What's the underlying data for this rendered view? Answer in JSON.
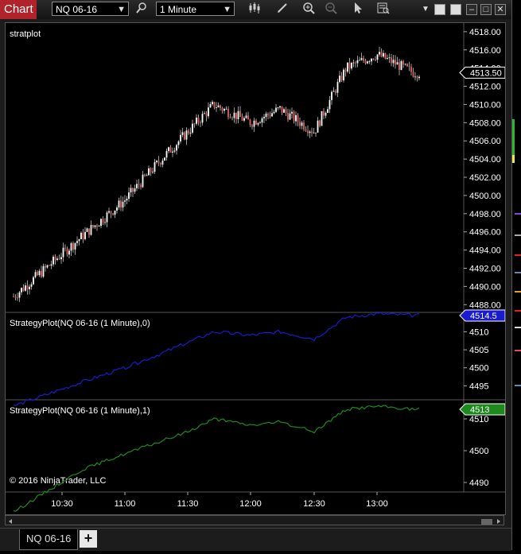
{
  "window": {
    "title": "Chart"
  },
  "toolbar": {
    "instrument": "NQ 06-16",
    "interval": "1 Minute",
    "icons": [
      "search-icon",
      "candlestick-style-icon",
      "draw-tool-icon",
      "zoom-in-icon",
      "zoom-out-icon",
      "pointer-icon",
      "data-box-icon",
      "dropdown-icon"
    ]
  },
  "tabs": [
    {
      "label": "NQ 06-16"
    }
  ],
  "add_tab_label": "+",
  "colors": {
    "background": "#000000",
    "price_line": "#ffffff",
    "plot1": "#1a1ad0",
    "plot2": "#1e8a1e",
    "up_candle": "#ffffff",
    "down_candle": "#e06060",
    "wick": "#dddddd"
  },
  "panels": [
    {
      "label": "stratplot",
      "y_ticks": [
        "4518.00",
        "4516.00",
        "4514.00",
        "4512.00",
        "4510.00",
        "4508.00",
        "4506.00",
        "4504.00",
        "4502.00",
        "4500.00",
        "4498.00",
        "4496.00",
        "4494.00",
        "4492.00",
        "4490.00",
        "4488.00"
      ],
      "last_value": "4513.50"
    },
    {
      "label": "StrategyPlot(NQ 06-16 (1 Minute),0)",
      "y_ticks": [
        "4510",
        "4505",
        "4500",
        "4495"
      ],
      "last_value": "4514.5"
    },
    {
      "label": "StrategyPlot(NQ 06-16 (1 Minute),1)",
      "y_ticks": [
        "4510",
        "4500",
        "4490"
      ],
      "last_value": "4513"
    }
  ],
  "x_ticks": [
    "10:30",
    "11:00",
    "11:30",
    "12:00",
    "12:30",
    "13:00"
  ],
  "copyright": "© 2016 NinjaTrader, LLC",
  "chart_data": [
    {
      "type": "candlestick",
      "title": "stratplot",
      "ylim": [
        4487.5,
        4518.6
      ],
      "x": [
        "10:30",
        "10:45",
        "11:00",
        "11:15",
        "11:30",
        "11:45",
        "12:00",
        "12:15",
        "12:30",
        "12:45",
        "13:00",
        "13:10"
      ],
      "close": [
        4493.5,
        4495.5,
        4499.5,
        4504.0,
        4507.0,
        4510.0,
        4508.0,
        4509.5,
        4507.0,
        4514.0,
        4515.5,
        4513.5
      ]
    },
    {
      "type": "line",
      "title": "StrategyPlot(NQ 06-16 (1 Minute),0)",
      "ylim": [
        4492,
        4514.5
      ],
      "x": [
        "10:30",
        "10:45",
        "11:00",
        "11:15",
        "11:30",
        "11:45",
        "12:00",
        "12:15",
        "12:30",
        "12:45",
        "13:00",
        "13:10"
      ],
      "values": [
        4494,
        4496,
        4500,
        4504,
        4507,
        4510,
        4509,
        4510,
        4508,
        4514,
        4515,
        4514.5
      ]
    },
    {
      "type": "line",
      "title": "StrategyPlot(NQ 06-16 (1 Minute),1)",
      "ylim": [
        4488,
        4515
      ],
      "x": [
        "10:30",
        "10:45",
        "11:00",
        "11:15",
        "11:30",
        "11:45",
        "12:00",
        "12:15",
        "12:30",
        "12:45",
        "13:00",
        "13:10"
      ],
      "values": [
        4490,
        4494,
        4499,
        4503,
        4506,
        4510,
        4508,
        4509,
        4506,
        4513,
        4514,
        4513
      ]
    }
  ]
}
